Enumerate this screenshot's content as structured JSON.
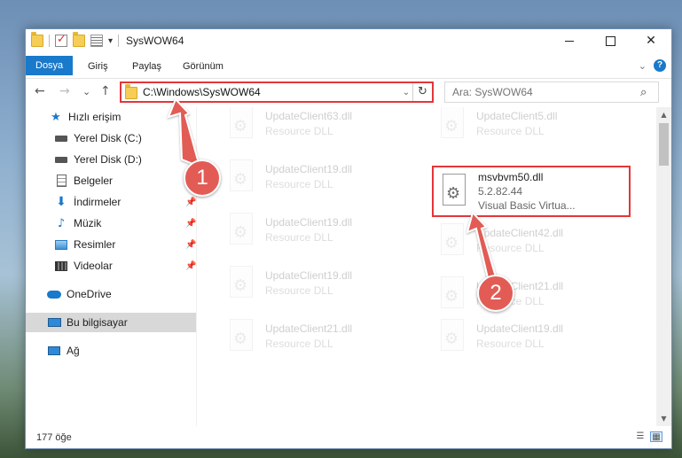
{
  "window": {
    "title": "SysWOW64",
    "controls": {
      "minimize": "",
      "maximize": "",
      "close": "✕"
    }
  },
  "ribbon": {
    "tabs": [
      "Dosya",
      "Giriş",
      "Paylaş",
      "Görünüm"
    ],
    "active_tab": "Dosya",
    "help": "?",
    "collapse": "⌄"
  },
  "nav": {
    "back": "←",
    "forward": "→",
    "recent": "⌄",
    "up": "↑",
    "address": "C:\\Windows\\SysWOW64",
    "address_dropdown": "⌄",
    "refresh": "↻",
    "search_placeholder": "Ara: SysWOW64",
    "search_icon": "⌕"
  },
  "sidebar": {
    "items": [
      {
        "label": "Hızlı erişim",
        "icon": "star-icon",
        "pinned": false
      },
      {
        "label": "Yerel Disk (C:)",
        "icon": "drive-icon",
        "pinned": false
      },
      {
        "label": "Yerel Disk (D:)",
        "icon": "drive-icon",
        "pinned": false
      },
      {
        "label": "Belgeler",
        "icon": "documents-icon",
        "pinned": true
      },
      {
        "label": "İndirmeler",
        "icon": "downloads-icon",
        "pinned": true
      },
      {
        "label": "Müzik",
        "icon": "music-icon",
        "pinned": true
      },
      {
        "label": "Resimler",
        "icon": "pictures-icon",
        "pinned": true
      },
      {
        "label": "Videolar",
        "icon": "videos-icon",
        "pinned": true
      },
      {
        "label": "OneDrive",
        "icon": "onedrive-icon",
        "pinned": false
      },
      {
        "label": "Bu bilgisayar",
        "icon": "this-pc-icon",
        "pinned": false,
        "selected": true
      },
      {
        "label": "Ağ",
        "icon": "network-icon",
        "pinned": false
      }
    ],
    "pin_glyph": "📌"
  },
  "files": [
    {
      "name": "UpdateClient63.dll",
      "desc": "Resource DLL"
    },
    {
      "name": "UpdateClient5.dll",
      "desc": "Resource DLL"
    },
    {
      "name": "UpdateClient19.dll",
      "desc": "Resource DLL"
    },
    {
      "name": "msvbvm50.dll",
      "desc": "5.2.82.44",
      "desc2": "Visual Basic Virtua...",
      "highlighted": true
    },
    {
      "name": "UpdateClient19.dll",
      "desc": "Resource DLL"
    },
    {
      "name": "UpdateClient42.dll",
      "desc": "Resource DLL"
    },
    {
      "name": "UpdateClient19.dll",
      "desc": "Resource DLL"
    },
    {
      "name": "UpdateClient21.dll",
      "desc": "Resource DLL"
    },
    {
      "name": "UpdateClient21.dll",
      "desc": "Resource DLL"
    },
    {
      "name": "UpdateClient19.dll",
      "desc": "Resource DLL"
    }
  ],
  "status": {
    "item_count": "177 öğe"
  },
  "annotations": {
    "badge1": "1",
    "badge2": "2",
    "arrow_color": "#e25c55",
    "highlight_color": "#e3363a"
  },
  "colors": {
    "accent": "#1979ca",
    "selection": "#d8d8d8"
  }
}
